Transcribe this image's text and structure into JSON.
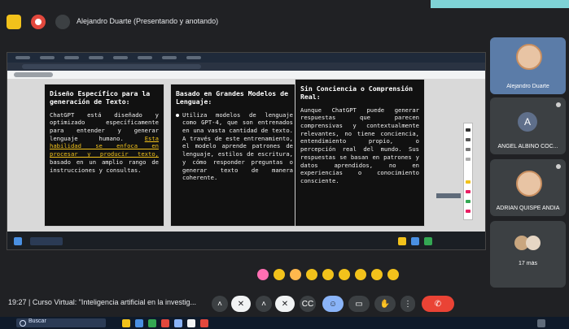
{
  "header": {
    "presenter_label": "Alejandro Duarte (Presentando y anotando)"
  },
  "slides": {
    "card1": {
      "title": "Diseño Específico para la generación de Texto:",
      "body_pre": "ChatGPT está diseñado y optimizado específicamente para entender y generar lenguaje humano.",
      "body_underlined": "Esta habilidad se enfoca en procesar y producir texto,",
      "body_post": "basado en un amplio rango de instrucciones y consultas."
    },
    "card2": {
      "title": "Basado en Grandes Modelos de Lenguaje:",
      "bullet": "Utiliza modelos de lenguaje como GPT-4, que son entrenados en una vasta cantidad de texto. A través de este entrenamiento, el modelo aprende patrones de lenguaje, estilos de escritura, y cómo responder preguntas o generar texto de manera coherente."
    },
    "card3": {
      "title": "Sin Conciencia o Comprensión Real:",
      "body": "Aunque ChatGPT puede generar respuestas que parecen comprensivas y contextualmente relevantes, no tiene conciencia, entendimiento propio, o percepción real del mundo. Sus respuestas se basan en patrones y datos aprendidos, no en experiencias o conocimiento consciente."
    }
  },
  "participants": [
    {
      "label": "Alejandro Duarte"
    },
    {
      "label": "ANGEL ALBINO COC...",
      "initial": "A"
    },
    {
      "label": "ADRIAN QUISPE ANDIA"
    },
    {
      "label": "17 más"
    }
  ],
  "bottom": {
    "meeting_info": "19:27 | Curso Virtual: \"Inteligencia artificial en la investig..."
  },
  "taskbar": {
    "search_label": "Buscar"
  }
}
